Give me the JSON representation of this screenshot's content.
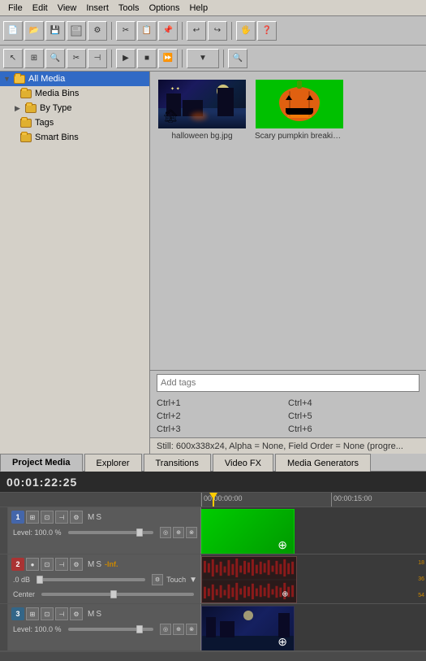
{
  "menu": {
    "items": [
      "File",
      "Edit",
      "View",
      "Insert",
      "Tools",
      "Options",
      "Help"
    ]
  },
  "toolbar1": {
    "buttons": [
      "new",
      "open",
      "save",
      "save-as",
      "settings",
      "undo",
      "redo",
      "help"
    ]
  },
  "toolbar2": {
    "buttons": [
      "arrow",
      "envelope",
      "zoom",
      "cut",
      "trim",
      "play",
      "stop",
      "fastforward",
      "dropdown",
      "search"
    ]
  },
  "tree": {
    "items": [
      {
        "label": "All Media",
        "level": 0,
        "selected": true,
        "expanded": true
      },
      {
        "label": "Media Bins",
        "level": 1,
        "selected": false
      },
      {
        "label": "By Type",
        "level": 1,
        "selected": false,
        "expandable": true
      },
      {
        "label": "Tags",
        "level": 1,
        "selected": false
      },
      {
        "label": "Smart Bins",
        "level": 1,
        "selected": false
      }
    ]
  },
  "media": {
    "items": [
      {
        "name": "halloween bg.jpg",
        "type": "image",
        "thumbnail_type": "halloween"
      },
      {
        "name": "Scary pumpkin breaking screen ef...",
        "type": "video",
        "thumbnail_type": "pumpkin"
      }
    ]
  },
  "tags": {
    "placeholder": "Add tags"
  },
  "shortcuts": [
    {
      "left": "Ctrl+1",
      "right": "Ctrl+4"
    },
    {
      "left": "Ctrl+2",
      "right": "Ctrl+5"
    },
    {
      "left": "Ctrl+3",
      "right": "Ctrl+6"
    }
  ],
  "status": {
    "text": "Still: 600x338x24, Alpha = None, Field Order = None (progre..."
  },
  "bottom_tabs": {
    "tabs": [
      "Project Media",
      "Explorer",
      "Transitions",
      "Video FX",
      "Media Generators"
    ],
    "active": "Project Media"
  },
  "timeline": {
    "current_time": "00:01:22:25",
    "ruler_marks": [
      {
        "time": "00:00:00:00",
        "position": 0
      },
      {
        "time": "00:00:15:00",
        "position": 160
      }
    ],
    "tracks": [
      {
        "number": "1",
        "color": "blue",
        "type": "video",
        "level": "Level: 100.0 %",
        "has_m": true,
        "has_s": true,
        "clip_type": "green"
      },
      {
        "number": "2",
        "color": "red",
        "type": "audio",
        "db": ".0 dB",
        "pan": "Center",
        "has_m": true,
        "has_s": true,
        "extra_label": "-Inf.",
        "clip_type": "waveform",
        "waveform_numbers": [
          "18",
          "36",
          "54"
        ]
      },
      {
        "number": "3",
        "color": "teal",
        "type": "video",
        "level": "Level: 100.0 %",
        "has_m": true,
        "has_s": true,
        "clip_type": "night"
      }
    ]
  }
}
